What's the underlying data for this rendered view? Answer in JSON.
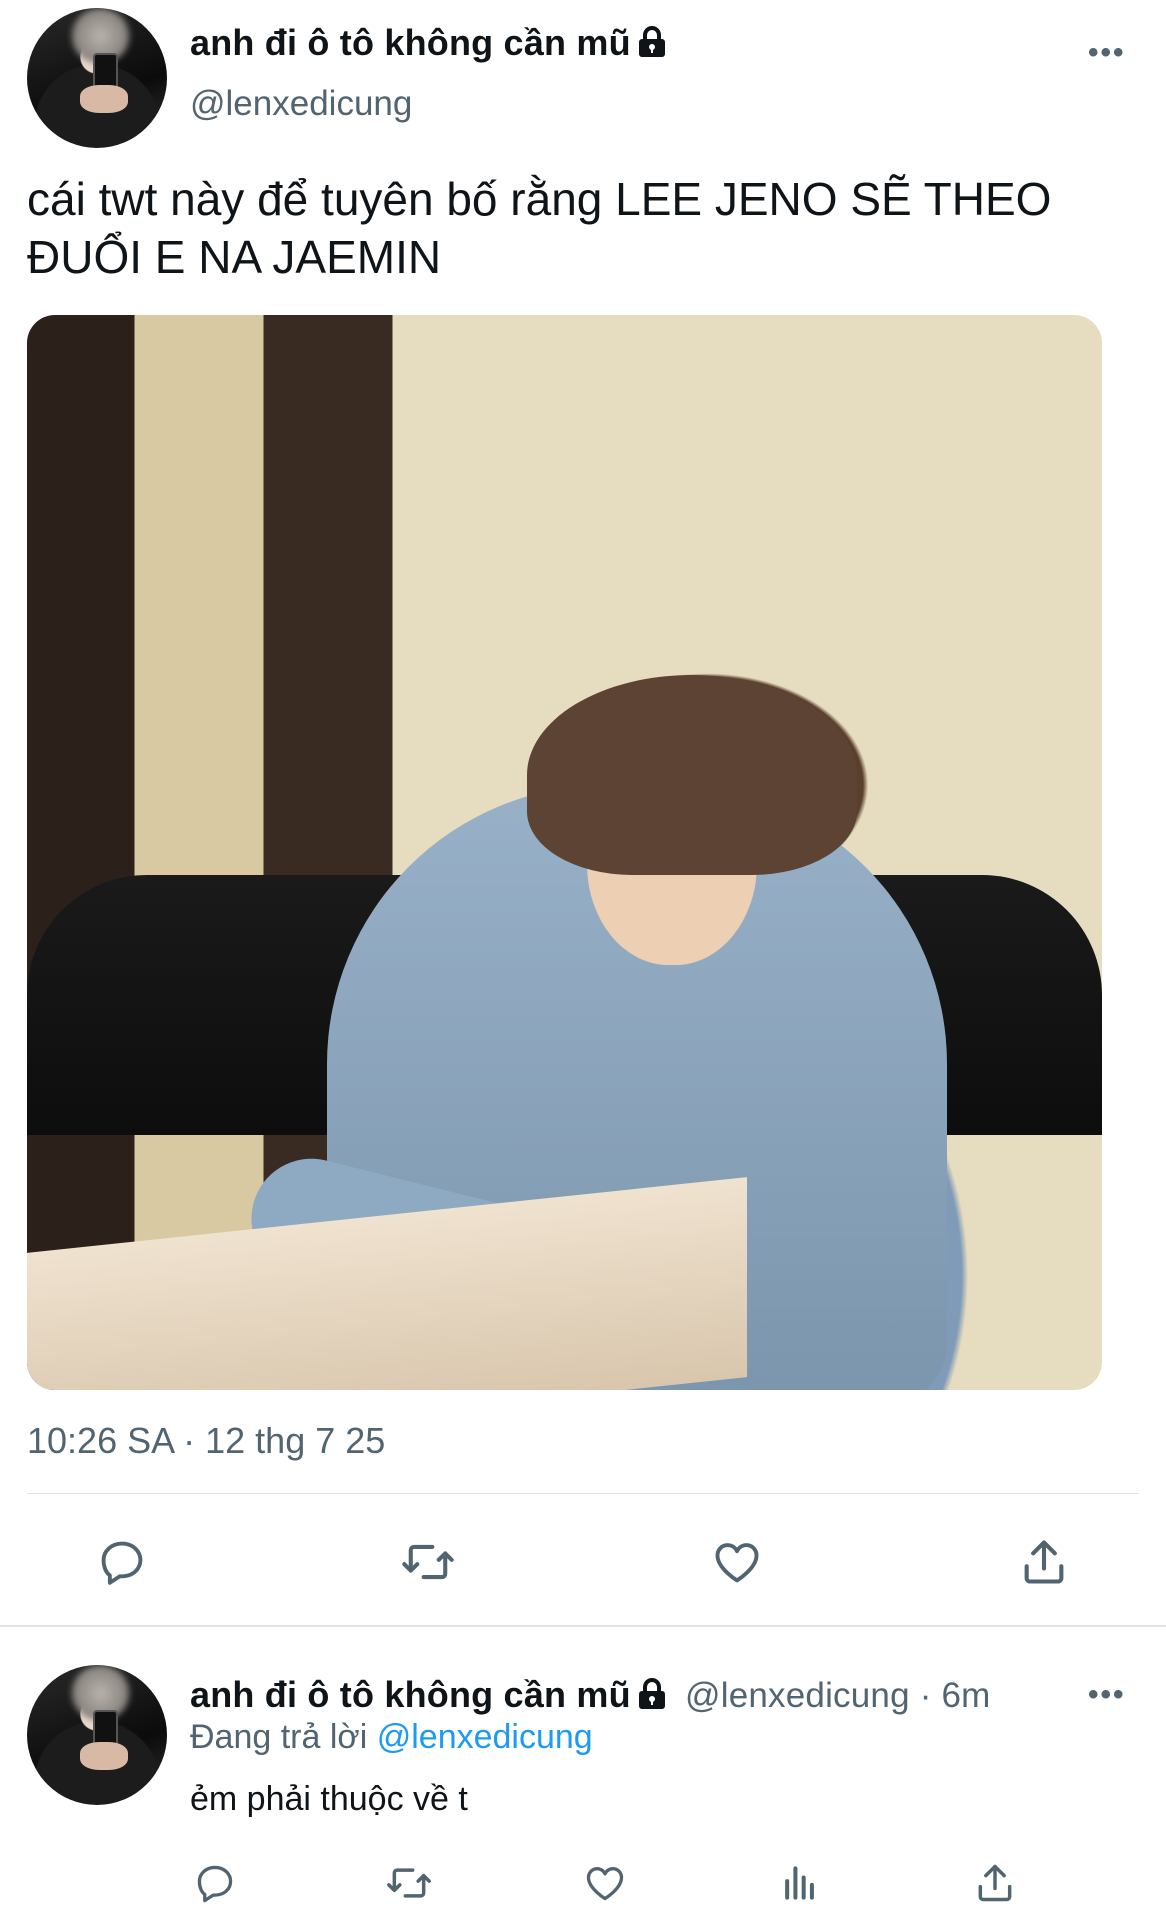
{
  "main_tweet": {
    "display_name": "anh đi ô tô không cần mũ",
    "username": "@lenxedicung",
    "text": "cái twt này để tuyên bố rằng LEE JENO SẼ THEO ĐUỔI E NA JAEMIN",
    "timestamp": "10:26 SA · 12 thg 7 25",
    "more_label": "•••",
    "actions": [
      "reply-icon",
      "retweet-icon",
      "like-icon",
      "share-icon"
    ]
  },
  "reply_tweet": {
    "display_name": "anh đi ô tô không cần mũ",
    "username": "@lenxedicung",
    "separator": "·",
    "time_ago": "6m",
    "replying_prefix": "Đang trả lời",
    "replying_to": "@lenxedicung",
    "text": "ẻm phải thuộc về t",
    "more_label": "•••",
    "actions": [
      "reply-icon",
      "retweet-icon",
      "like-icon",
      "views-icon",
      "share-icon"
    ]
  },
  "colors": {
    "text_primary": "#0f1419",
    "text_secondary": "#536471",
    "link": "#1d9bf0",
    "divider": "#dfe3e6"
  }
}
